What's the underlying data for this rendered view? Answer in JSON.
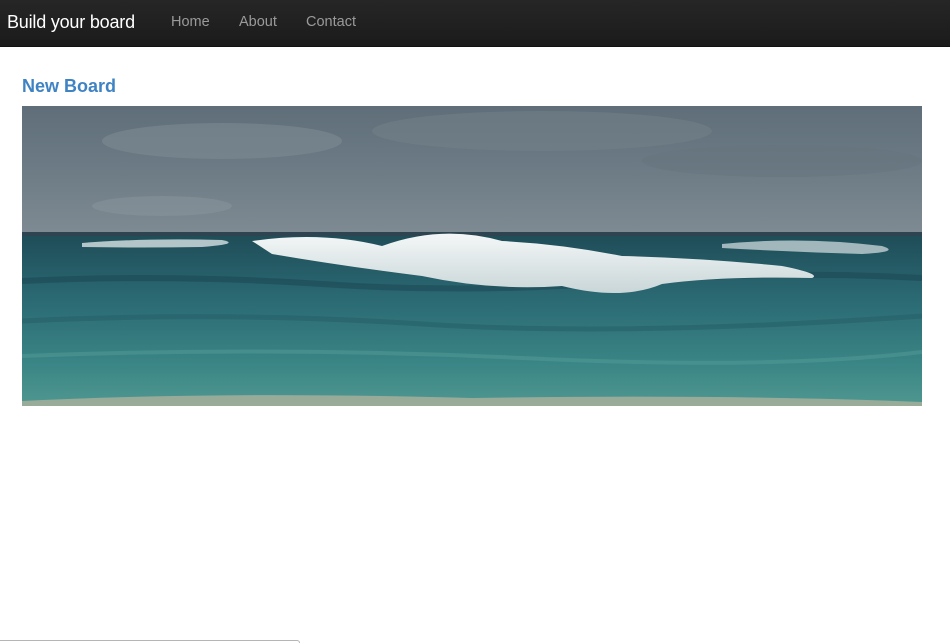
{
  "navbar": {
    "brand": "Build your board",
    "links": [
      "Home",
      "About",
      "Contact"
    ]
  },
  "board": {
    "title": "New Board",
    "image_icon": "ocean-wave-photo"
  },
  "colors": {
    "navbar_bg": "#222222",
    "brand_text": "#ffffff",
    "nav_text": "#9a9a9a",
    "title_link": "#3e83c3"
  }
}
